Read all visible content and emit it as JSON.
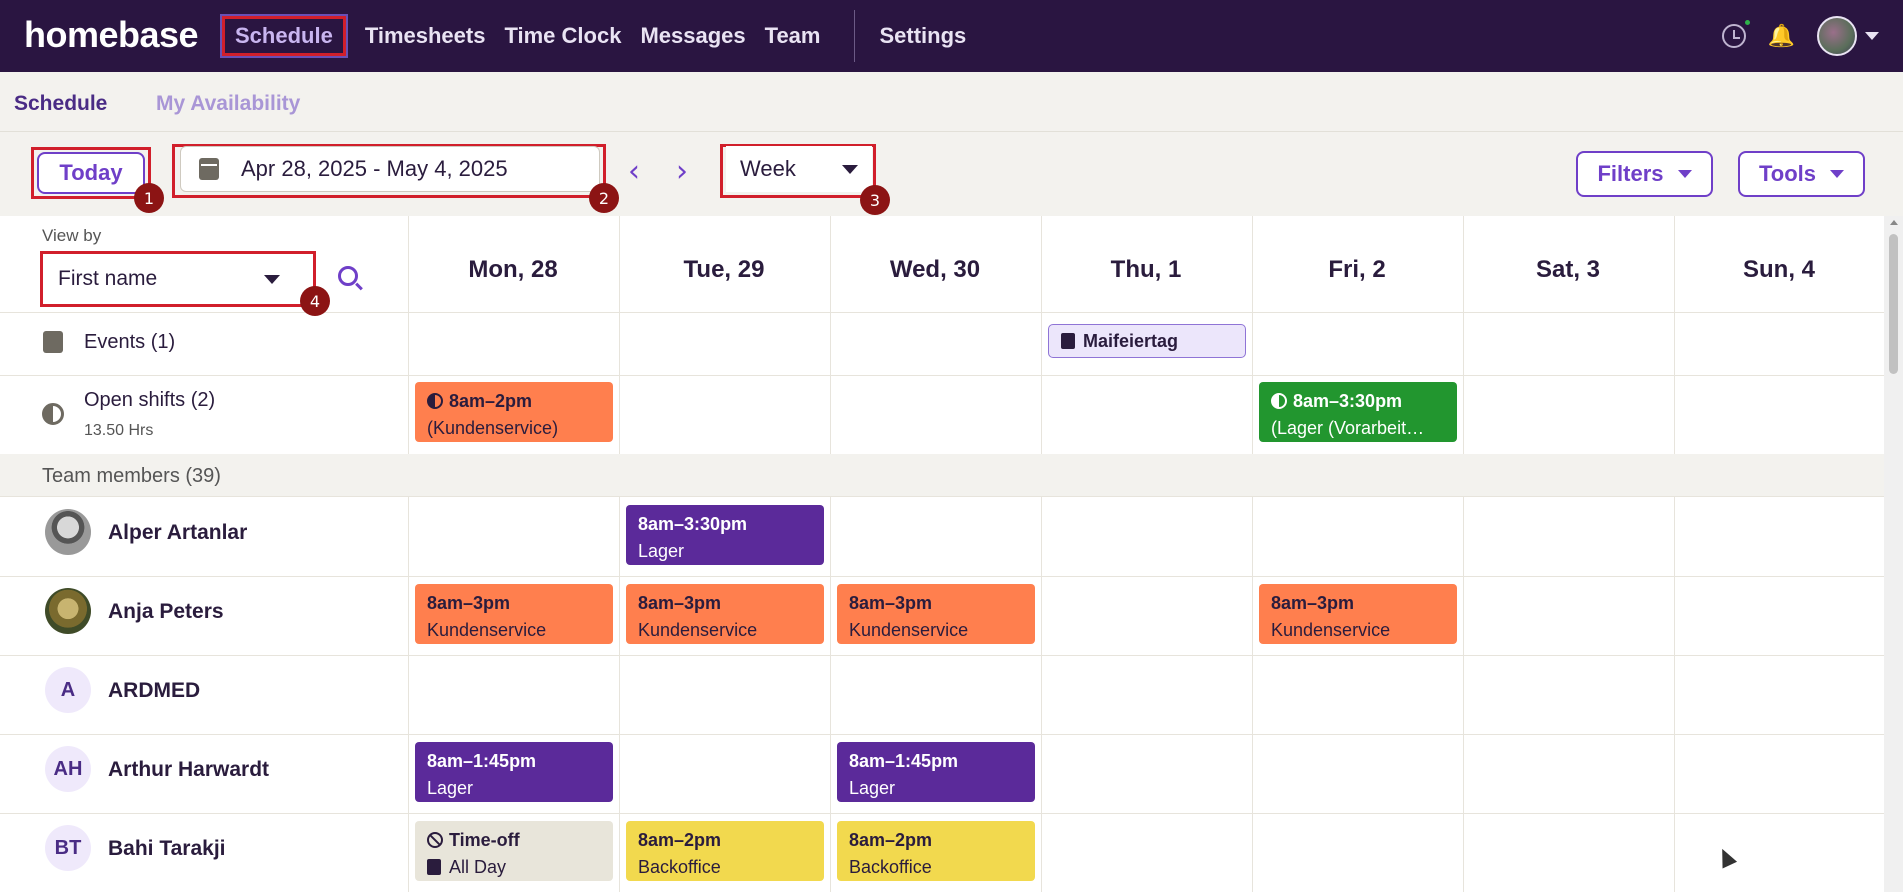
{
  "nav": {
    "logo": "homebase",
    "links": [
      "Schedule",
      "Timesheets",
      "Time Clock",
      "Messages",
      "Team"
    ],
    "settings": "Settings"
  },
  "subnav": {
    "tabs": [
      "Schedule",
      "My Availability"
    ]
  },
  "toolbar": {
    "today": "Today",
    "date_range": "Apr 28, 2025 - May 4, 2025",
    "prev": "‹",
    "next": "›",
    "view": "Week",
    "filters": "Filters",
    "tools": "Tools",
    "badges": [
      "1",
      "2",
      "3",
      "4"
    ]
  },
  "grid": {
    "view_by_label": "View by",
    "view_by_value": "First name",
    "days": [
      "Mon, 28",
      "Tue, 29",
      "Wed, 30",
      "Thu, 1",
      "Fri, 2",
      "Sat, 3",
      "Sun, 4"
    ],
    "events_label": "Events (1)",
    "event_chip": "Maifeiertag",
    "open_shifts_label": "Open shifts (2)",
    "open_shifts_hours": "13.50 Hrs",
    "open_shifts": [
      {
        "time": "8am–2pm",
        "role": "(Kundenservice)"
      },
      {
        "time": "8am–3:30pm",
        "role": "(Lager (Vorarbeit…"
      }
    ],
    "team_label": "Team members (39)",
    "members": [
      {
        "name": "Alper Artanlar",
        "initials": ""
      },
      {
        "name": "Anja Peters",
        "initials": ""
      },
      {
        "name": "ARDMED",
        "initials": "A"
      },
      {
        "name": "Arthur Harwardt",
        "initials": "AH"
      },
      {
        "name": "Bahi Tarakji",
        "initials": "BT"
      }
    ],
    "shifts": {
      "alper_tue": {
        "time": "8am–3:30pm",
        "role": "Lager"
      },
      "anja_mon": {
        "time": "8am–3pm",
        "role": "Kundenservice"
      },
      "anja_tue": {
        "time": "8am–3pm",
        "role": "Kundenservice"
      },
      "anja_wed": {
        "time": "8am–3pm",
        "role": "Kundenservice"
      },
      "anja_fri": {
        "time": "8am–3pm",
        "role": "Kundenservice"
      },
      "arthur_mon": {
        "time": "8am–1:45pm",
        "role": "Lager"
      },
      "arthur_wed": {
        "time": "8am–1:45pm",
        "role": "Lager"
      },
      "bahi_mon": {
        "time": "Time-off",
        "role": "All Day"
      },
      "bahi_tue": {
        "time": "8am–2pm",
        "role": "Backoffice"
      },
      "bahi_wed": {
        "time": "8am–2pm",
        "role": "Backoffice"
      }
    }
  },
  "colors": {
    "nav": "#2a1541",
    "accent": "#6f3fc8",
    "orange": "#ff7f4e",
    "purple": "#5b2a9a",
    "green": "#22962f",
    "yellow": "#f2d94e"
  }
}
